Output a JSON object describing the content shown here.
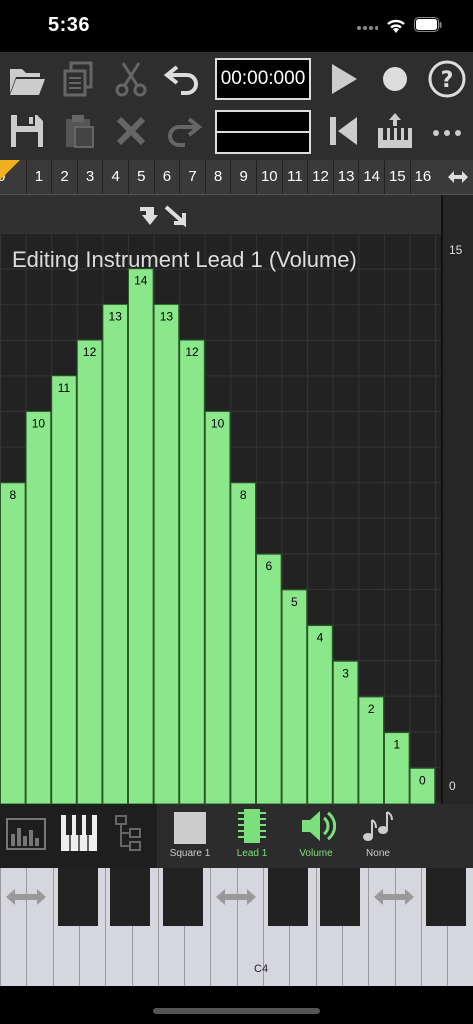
{
  "status": {
    "time": "5:36"
  },
  "toolbar": {
    "time_display": "00:00:000",
    "buttons": [
      "open-folder-icon",
      "copy-icon",
      "cut-icon",
      "undo-icon",
      "play-icon",
      "record-icon",
      "help-icon",
      "save-icon",
      "paste-icon",
      "delete-icon",
      "redo-icon",
      "rewind-icon",
      "piano-import-icon",
      "more-icon"
    ]
  },
  "ruler": {
    "ticks": [
      "0",
      "1",
      "2",
      "3",
      "4",
      "5",
      "6",
      "7",
      "8",
      "9",
      "10",
      "11",
      "12",
      "13",
      "14",
      "15",
      "16"
    ]
  },
  "editor": {
    "title": "Editing Instrument Lead 1 (Volume)",
    "scale_top": "15",
    "scale_bottom": "0",
    "bar_color": "#8ae88a"
  },
  "chart_data": {
    "type": "bar",
    "categories": [
      "0",
      "1",
      "2",
      "3",
      "4",
      "5",
      "6",
      "7",
      "8",
      "9",
      "10",
      "11",
      "12",
      "13",
      "14",
      "15",
      "16"
    ],
    "values": [
      8,
      10,
      11,
      12,
      13,
      14,
      13,
      12,
      10,
      8,
      6,
      5,
      4,
      3,
      2,
      1,
      0
    ],
    "ylim": [
      0,
      15
    ]
  },
  "panel": {
    "tabs": [
      {
        "label": "Square 1",
        "icon": "square-icon",
        "active": false
      },
      {
        "label": "Lead 1",
        "icon": "chip-icon",
        "active": true
      },
      {
        "label": "Volume",
        "icon": "speaker-icon",
        "active": true
      },
      {
        "label": "None",
        "icon": "notes-icon",
        "active": false
      }
    ],
    "accent": "#7be07b"
  },
  "keyboard": {
    "c_label": "C4"
  }
}
